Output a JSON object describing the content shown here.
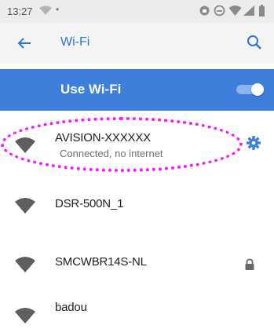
{
  "status_bar": {
    "time": "13:27",
    "dot": "•",
    "icons": [
      "signal-icon",
      "lock-circle-icon",
      "wifi-status-icon",
      "cellular-icon",
      "battery-icon"
    ]
  },
  "header": {
    "title": "Wi-Fi",
    "back_icon": "arrow-left-icon",
    "search_icon": "search-icon"
  },
  "master_switch": {
    "label": "Use Wi-Fi",
    "state": "on",
    "accent": "#3f7fdc"
  },
  "networks": [
    {
      "name": "AVISION-XXXXXX",
      "status": "Connected, no internet",
      "trailing_icon": "gear-icon",
      "highlighted": true
    },
    {
      "name": "DSR-500N_1",
      "status": "",
      "trailing_icon": "",
      "highlighted": false
    },
    {
      "name": "SMCWBR14S-NL",
      "status": "",
      "trailing_icon": "lock-icon",
      "highlighted": false
    },
    {
      "name": "badou",
      "status": "",
      "trailing_icon": "",
      "highlighted": false
    }
  ],
  "highlight_color": "#ff14ff"
}
